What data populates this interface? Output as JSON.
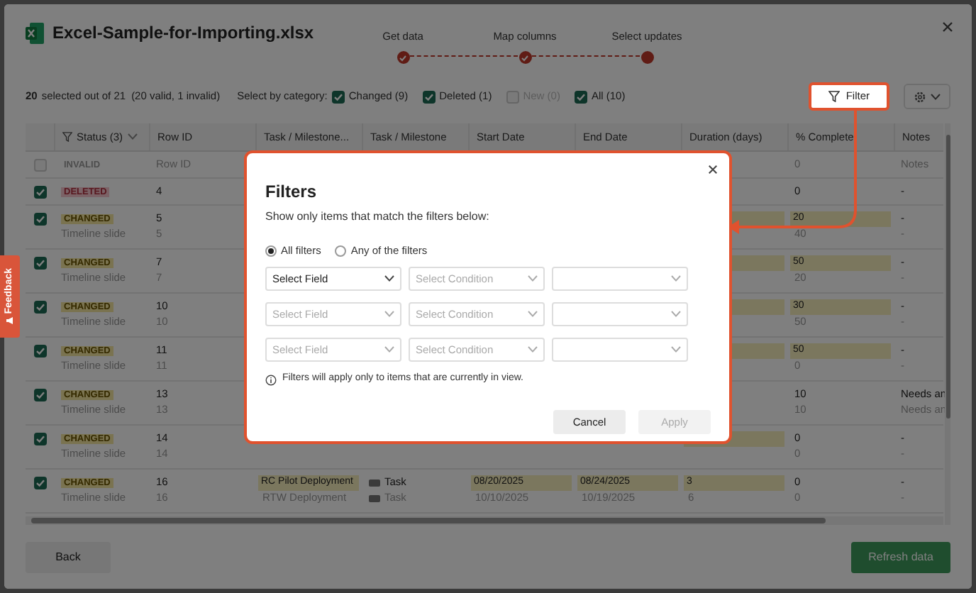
{
  "header": {
    "title": "Excel-Sample-for-Importing.xlsx",
    "steps": [
      {
        "label": "Get data",
        "done": true
      },
      {
        "label": "Map columns",
        "done": true
      },
      {
        "label": "Select updates",
        "done": false
      }
    ]
  },
  "summary": {
    "count": "20",
    "text": "selected out of 21",
    "detail": "(20 valid, 1 invalid)"
  },
  "category_label": "Select by category:",
  "categories": [
    {
      "label": "Changed (9)",
      "checked": true,
      "disabled": false
    },
    {
      "label": "Deleted (1)",
      "checked": true,
      "disabled": false
    },
    {
      "label": "New (0)",
      "checked": false,
      "disabled": true
    },
    {
      "label": "All (10)",
      "checked": true,
      "disabled": false
    }
  ],
  "filter_button": "Filter",
  "columns": [
    "Status (3)",
    "Row ID",
    "Task / Milestone...",
    "Task / Milestone",
    "Start Date",
    "End Date",
    "Duration (days)",
    "% Complete",
    "Notes"
  ],
  "rows": [
    {
      "kind": "invalid",
      "checked": false,
      "status": "INVALID",
      "cells": [
        {
          "text": "Row ID",
          "changed": false
        },
        {
          "changed": false
        },
        {
          "changed": false
        },
        {
          "changed": false
        },
        {
          "changed": false
        },
        {
          "changed": false
        },
        {
          "text": "0",
          "changed": false
        },
        {
          "text": "Notes",
          "changed": false
        }
      ]
    },
    {
      "kind": "deleted",
      "checked": true,
      "status": "DELETED",
      "cells": [
        {
          "text": "4",
          "changed": false
        },
        {
          "changed": false
        },
        {
          "changed": false
        },
        {
          "changed": false
        },
        {
          "changed": false
        },
        {
          "changed": false
        },
        {
          "text": "0",
          "changed": false
        },
        {
          "text": "-",
          "changed": false
        }
      ]
    },
    {
      "kind": "changed",
      "checked": true,
      "status": "CHANGED",
      "cells": [
        {
          "text": "5",
          "changed": false
        },
        {
          "changed": false
        },
        {
          "changed": false
        },
        {
          "changed": false
        },
        {
          "changed": false
        },
        {
          "changed": true
        },
        {
          "text": "20",
          "changed": true
        },
        {
          "text": "-",
          "changed": false
        }
      ],
      "sub": {
        "label": "Timeline slide",
        "cells": [
          {
            "text": "5"
          },
          {},
          {},
          {},
          {},
          {},
          {
            "text": "40"
          },
          {
            "text": "-"
          }
        ]
      }
    },
    {
      "kind": "changed",
      "checked": true,
      "status": "CHANGED",
      "cells": [
        {
          "text": "7",
          "changed": false
        },
        {
          "changed": false
        },
        {
          "changed": false
        },
        {
          "changed": false
        },
        {
          "changed": false
        },
        {
          "changed": true
        },
        {
          "text": "50",
          "changed": true
        },
        {
          "text": "-",
          "changed": false
        }
      ],
      "sub": {
        "label": "Timeline slide",
        "cells": [
          {
            "text": "7"
          },
          {},
          {},
          {},
          {},
          {},
          {
            "text": "20"
          },
          {
            "text": "-"
          }
        ]
      }
    },
    {
      "kind": "changed",
      "checked": true,
      "status": "CHANGED",
      "cells": [
        {
          "text": "10",
          "changed": false
        },
        {
          "changed": false
        },
        {
          "changed": false
        },
        {
          "changed": false
        },
        {
          "changed": false
        },
        {
          "changed": true
        },
        {
          "text": "30",
          "changed": true
        },
        {
          "text": "-",
          "changed": false
        }
      ],
      "sub": {
        "label": "Timeline slide",
        "cells": [
          {
            "text": "10"
          },
          {},
          {},
          {},
          {},
          {},
          {
            "text": "50"
          },
          {
            "text": "-"
          }
        ]
      }
    },
    {
      "kind": "changed",
      "checked": true,
      "status": "CHANGED",
      "cells": [
        {
          "text": "11",
          "changed": false
        },
        {
          "changed": false
        },
        {
          "changed": false
        },
        {
          "changed": false
        },
        {
          "changed": false
        },
        {
          "changed": true
        },
        {
          "text": "50",
          "changed": true
        },
        {
          "text": "-",
          "changed": false
        }
      ],
      "sub": {
        "label": "Timeline slide",
        "cells": [
          {
            "text": "11"
          },
          {},
          {},
          {},
          {},
          {},
          {
            "text": "0"
          },
          {
            "text": "-"
          }
        ]
      }
    },
    {
      "kind": "changed",
      "checked": true,
      "status": "CHANGED",
      "cells": [
        {
          "text": "13",
          "changed": false
        },
        {
          "changed": false
        },
        {
          "changed": false
        },
        {
          "changed": false
        },
        {
          "changed": false
        },
        {
          "changed": false
        },
        {
          "text": "10",
          "changed": false
        },
        {
          "text": "Needs an",
          "changed": false
        }
      ],
      "sub": {
        "label": "Timeline slide",
        "cells": [
          {
            "text": "13"
          },
          {},
          {},
          {},
          {},
          {},
          {
            "text": "10"
          },
          {
            "text": "Needs an"
          }
        ]
      }
    },
    {
      "kind": "changed",
      "checked": true,
      "status": "CHANGED",
      "cells": [
        {
          "text": "14",
          "changed": false
        },
        {
          "changed": false
        },
        {
          "changed": false
        },
        {
          "changed": false
        },
        {
          "changed": false
        },
        {
          "changed": true
        },
        {
          "text": "0",
          "changed": false
        },
        {
          "text": "-",
          "changed": false
        }
      ],
      "sub": {
        "label": "Timeline slide",
        "cells": [
          {
            "text": "14"
          },
          {},
          {},
          {},
          {},
          {},
          {
            "text": "0"
          },
          {
            "text": "-"
          }
        ]
      }
    },
    {
      "kind": "changed",
      "checked": true,
      "status": "CHANGED",
      "cells": [
        {
          "text": "16",
          "changed": false
        },
        {
          "text": "RC Pilot Deployment",
          "changed": true
        },
        {
          "text": "Task",
          "changed": false
        },
        {
          "text": "08/20/2025",
          "changed": true
        },
        {
          "text": "08/24/2025",
          "changed": true
        },
        {
          "text": "3",
          "changed": true
        },
        {
          "text": "0",
          "changed": false
        },
        {
          "text": "-",
          "changed": false
        }
      ],
      "sub": {
        "label": "Timeline slide",
        "cells": [
          {
            "text": "16"
          },
          {
            "text": "RTW Deployment"
          },
          {
            "text": "Task"
          },
          {
            "text": "10/10/2025"
          },
          {
            "text": "10/19/2025"
          },
          {
            "text": "6"
          },
          {
            "text": "0"
          },
          {
            "text": "-"
          }
        ]
      }
    }
  ],
  "modal": {
    "title": "Filters",
    "subtitle": "Show only items that match the filters below:",
    "modes": [
      {
        "label": "All filters",
        "selected": true
      },
      {
        "label": "Any of the filters",
        "selected": false
      }
    ],
    "filters": [
      {
        "field": "Select Field",
        "enabled": true,
        "condition": "Select Condition"
      },
      {
        "field": "Select Field",
        "enabled": false,
        "condition": "Select Condition"
      },
      {
        "field": "Select Field",
        "enabled": false,
        "condition": "Select Condition"
      }
    ],
    "note": "Filters will apply only to items that are currently in view.",
    "buttons": [
      {
        "label": "Cancel",
        "disabled": false
      },
      {
        "label": "Apply",
        "disabled": true
      }
    ]
  },
  "footer": {
    "back": "Back",
    "refresh": "Refresh data"
  },
  "feedback": "Feedback"
}
